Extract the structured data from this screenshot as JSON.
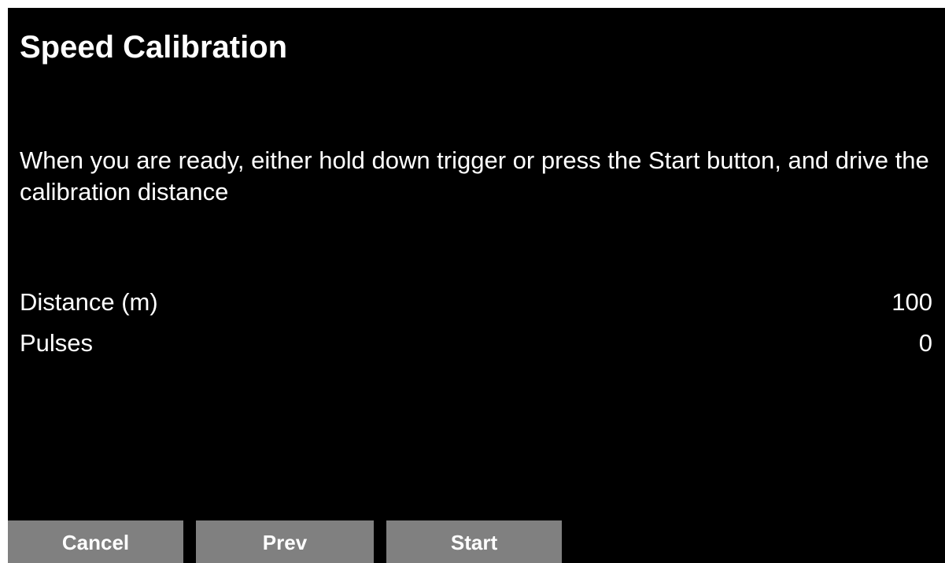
{
  "screen": {
    "title": "Speed Calibration",
    "instructions": "When you are ready, either hold down trigger or press the Start button, and drive the calibration distance",
    "readings": [
      {
        "label": "Distance (m)",
        "value": "100"
      },
      {
        "label": "Pulses",
        "value": "0"
      }
    ]
  },
  "buttons": {
    "cancel_label": "Cancel",
    "prev_label": "Prev",
    "start_label": "Start"
  },
  "colors": {
    "background": "#000000",
    "text": "#ffffff",
    "button": "#808080",
    "frame": "#ffffff"
  }
}
